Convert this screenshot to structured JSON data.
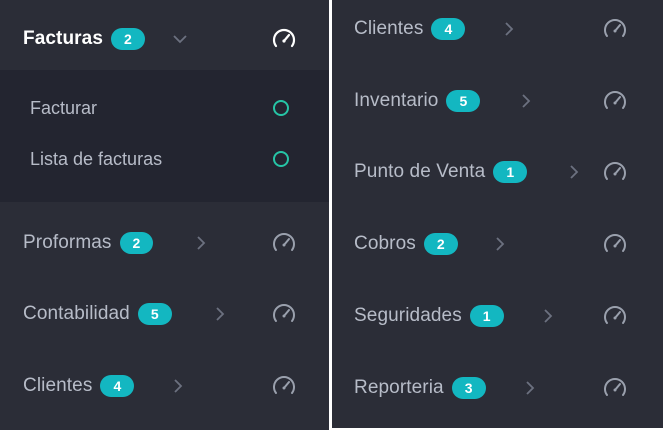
{
  "left_panel": {
    "active": {
      "label": "Facturas",
      "badge": "2"
    },
    "submenu": [
      {
        "label": "Facturar"
      },
      {
        "label": "Lista de facturas"
      }
    ],
    "items": [
      {
        "label": "Proformas",
        "badge": "2"
      },
      {
        "label": "Contabilidad",
        "badge": "5"
      },
      {
        "label": "Clientes",
        "badge": "4"
      }
    ]
  },
  "right_panel": {
    "items": [
      {
        "label": "Clientes",
        "badge": "4"
      },
      {
        "label": "Inventario",
        "badge": "5"
      },
      {
        "label": "Punto de Venta",
        "badge": "1"
      },
      {
        "label": "Cobros",
        "badge": "2"
      },
      {
        "label": "Seguridades",
        "badge": "1"
      },
      {
        "label": "Reporteria",
        "badge": "3"
      }
    ]
  },
  "colors": {
    "panel_bg": "#2b2d37",
    "submenu_bg": "#232530",
    "badge_bg": "#13b7c1",
    "submenu_dot": "#26c5a6",
    "label_text": "#b7bcc8",
    "active_text": "#ffffff"
  },
  "icons": {
    "expanded_chevron": "chevron-down-icon",
    "collapsed_chevron": "chevron-right-icon",
    "row_icon": "speedometer-icon",
    "submenu_marker": "circle-outline-icon"
  }
}
